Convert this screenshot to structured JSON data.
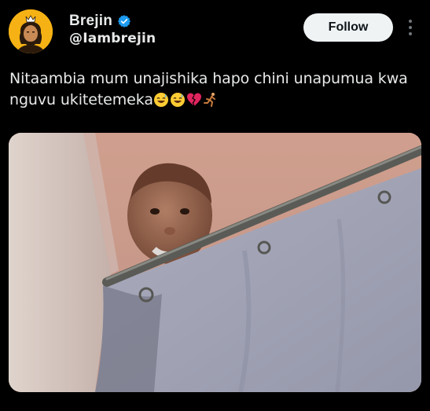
{
  "author": {
    "display_name": "Brejin",
    "handle": "@Iambrejin",
    "verified_icon": "verified-badge-icon",
    "avatar_icon": "avatar-illustration",
    "avatar_color": "#f6b214"
  },
  "follow_button": {
    "label": "Follow"
  },
  "more_menu": {
    "icon": "more-vertical-icon"
  },
  "tweet": {
    "text_line_1": "Nitaambia mum unajishika hapo chini  unapumua kwa",
    "text_line_2": "nguvu ukitetemeka",
    "emojis": [
      "grinning-sweat-emoji",
      "grinning-sweat-emoji",
      "broken-heart-emoji",
      "running-person-emoji"
    ]
  },
  "media": {
    "icon": "photo-baby-peeking-over-shower-curtain"
  },
  "colors": {
    "background": "#000000",
    "text": "#e7e9ea",
    "follow_bg": "#eff3f4",
    "follow_text": "#0f1419",
    "verified": "#1d9bf0"
  }
}
